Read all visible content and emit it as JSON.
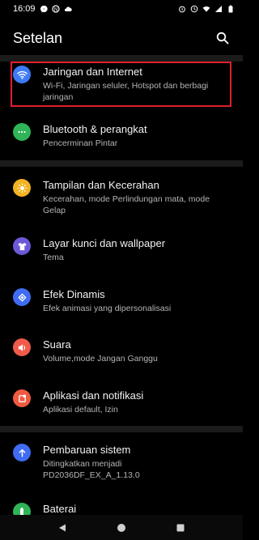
{
  "status_bar": {
    "time": "16:09"
  },
  "app_bar": {
    "title": "Setelan"
  },
  "settings": [
    {
      "label": "Jaringan dan Internet",
      "summary": "Wi-Fi, Jaringan seluler, Hotspot dan berbagi jaringan",
      "icon": "wifi-icon",
      "color": "#3d7bf7"
    },
    {
      "label": "Bluetooth & perangkat",
      "summary": "Pencerminan Pintar",
      "icon": "bluetooth-devices-icon",
      "color": "#2fb457"
    },
    {
      "label": "Tampilan dan Kecerahan",
      "summary": "Kecerahan, mode Perlindungan mata, mode Gelap",
      "icon": "brightness-icon",
      "color": "#f2b322"
    },
    {
      "label": "Layar kunci dan wallpaper",
      "summary": "Tema",
      "icon": "theme-shirt-icon",
      "color": "#6b5ad8"
    },
    {
      "label": "Efek Dinamis",
      "summary": "Efek animasi yang dipersonalisasi",
      "icon": "dynamic-effects-icon",
      "color": "#3f6cf2"
    },
    {
      "label": "Suara",
      "summary": "Volume,mode Jangan Ganggu",
      "icon": "sound-icon",
      "color": "#ef5a4a"
    },
    {
      "label": "Aplikasi dan notifikasi",
      "summary": "Aplikasi default, Izin",
      "icon": "apps-icon",
      "color": "#ef5a40"
    },
    {
      "label": "Pembaruan sistem",
      "summary": "Ditingkatkan menjadi PD2036DF_EX_A_1.13.0",
      "icon": "system-update-icon",
      "color": "#3f6cf2"
    },
    {
      "label": "Baterai",
      "summary": "",
      "icon": "battery-icon",
      "color": "#2fb457"
    }
  ],
  "colors": {
    "background": "#000000",
    "divider": "#1b1b1b",
    "highlight_border": "#e0202a"
  }
}
